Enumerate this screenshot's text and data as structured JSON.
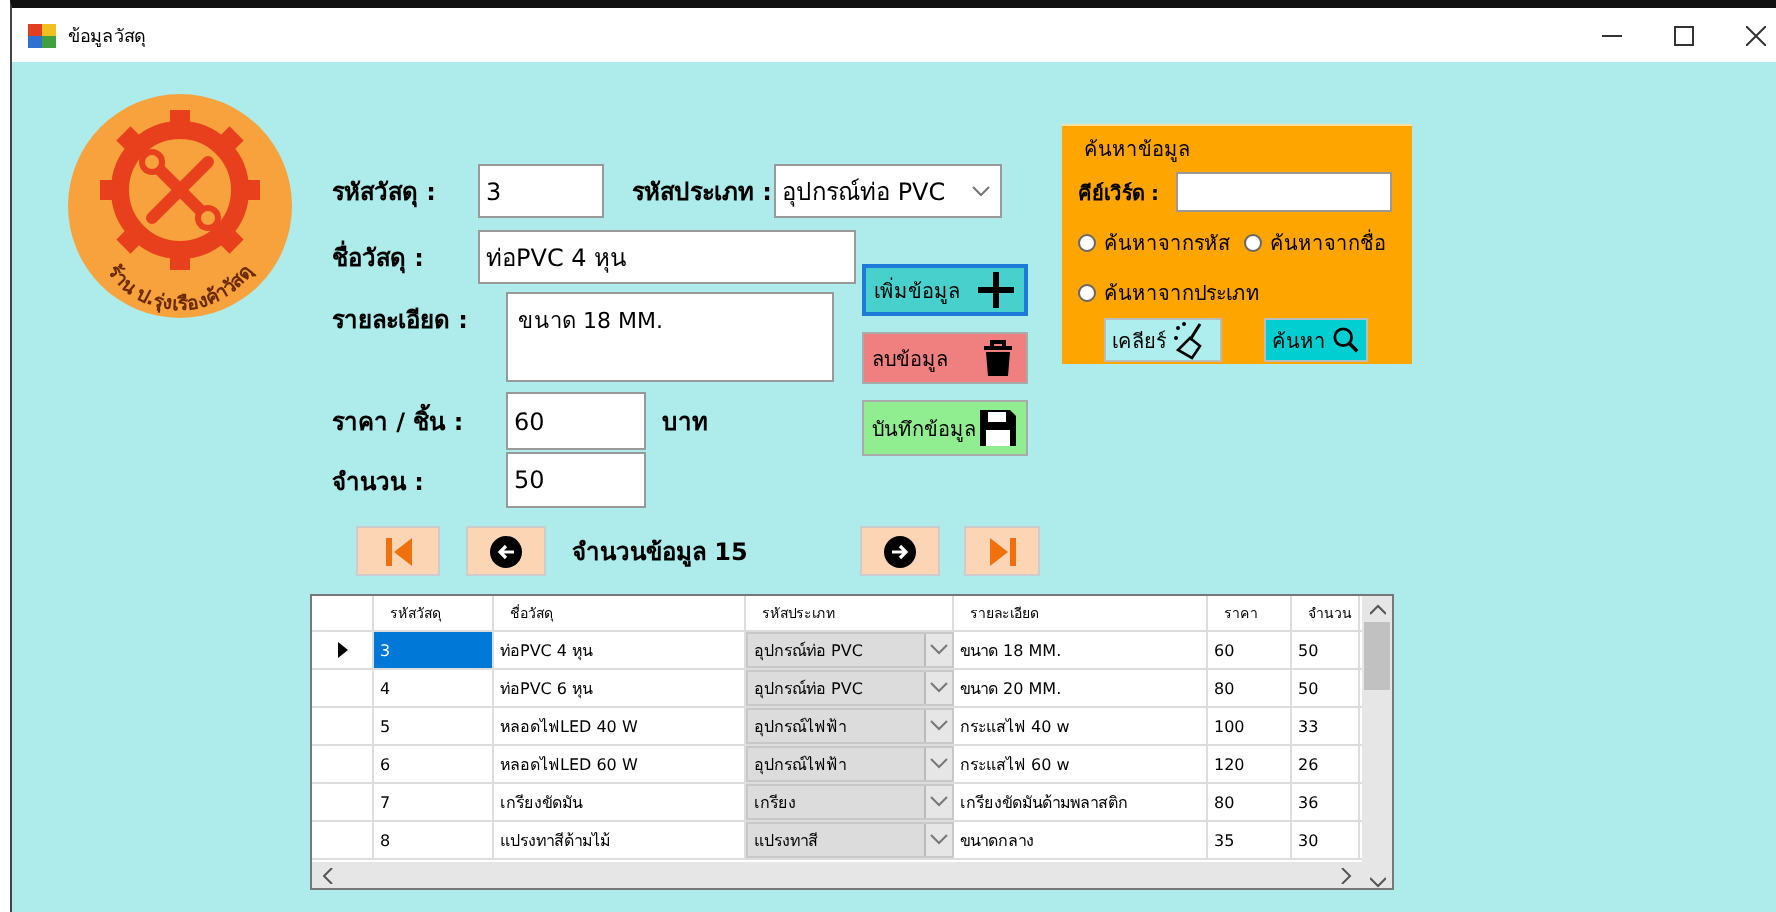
{
  "window": {
    "title": "ข้อมูลวัสดุ"
  },
  "logo": {
    "text": "ร้าน ป.รุ่งเรืองค้าวัสดุ"
  },
  "form": {
    "material_id": {
      "label": "รหัสวัสดุ :",
      "value": "3"
    },
    "type_code": {
      "label": "รหัสประเภท :",
      "value": "อุปกรณ์ท่อ PVC"
    },
    "name": {
      "label": "ชื่อวัสดุ :",
      "value": "ท่อPVC 4 หุน"
    },
    "detail": {
      "label": "รายละเอียด :",
      "value": "ขนาด 18 MM."
    },
    "price": {
      "label": "ราคา / ชิ้น :",
      "value": "60",
      "unit": "บาท"
    },
    "quantity": {
      "label": "จำนวน :",
      "value": "50"
    }
  },
  "actions": [
    {
      "label": "เพิ่มข้อมูล",
      "kind": "add",
      "focused": true
    },
    {
      "label": "ลบข้อมูล",
      "kind": "delete",
      "focused": false
    },
    {
      "label": "บันทึกข้อมูล",
      "kind": "save",
      "focused": false
    }
  ],
  "search": {
    "title": "ค้นหาข้อมูล",
    "keyword_label": "คีย์เวิร์ด :",
    "options": [
      {
        "label": "ค้นหาจากรหัส",
        "selected": false
      },
      {
        "label": "ค้นหาจากชื่อ",
        "selected": false
      },
      {
        "label": "ค้นหาจากประเภท",
        "selected": false
      }
    ],
    "buttons": [
      {
        "label": "เคลียร์",
        "kind": "clear"
      },
      {
        "label": "ค้นหา",
        "kind": "search"
      }
    ]
  },
  "navigator": {
    "buttons": [
      {
        "kind": "first"
      },
      {
        "kind": "prev"
      },
      {
        "kind": "next"
      },
      {
        "kind": "last"
      }
    ],
    "count_label": "จำนวนข้อมูล 15"
  },
  "table": {
    "columns": [
      "รหัสวัสดุ",
      "ชื่อวัสดุ",
      "รหัสประเภท",
      "รายละเอียด",
      "ราคา",
      "จำนวน"
    ],
    "rows": [
      {
        "cells": [
          "3",
          "ท่อPVC 4 หุน",
          "อุปกรณ์ท่อ PVC",
          "ขนาด 18 MM.",
          "60",
          "50"
        ],
        "selected": true
      },
      {
        "cells": [
          "4",
          "ท่อPVC 6 หุน",
          "อุปกรณ์ท่อ PVC",
          "ขนาด 20 MM.",
          "80",
          "50"
        ],
        "selected": false
      },
      {
        "cells": [
          "5",
          "หลอดไฟLED 40 W",
          "อุปกรณ์ไฟฟ้า",
          "กระแสไฟ 40 w",
          "100",
          "33"
        ],
        "selected": false
      },
      {
        "cells": [
          "6",
          "หลอดไฟLED 60 W",
          "อุปกรณ์ไฟฟ้า",
          "กระแสไฟ 60 w",
          "120",
          "26"
        ],
        "selected": false
      },
      {
        "cells": [
          "7",
          "เกรียงขัดมัน",
          "เกรียง",
          "เกรียงขัดมันด้ามพลาสติก",
          "80",
          "36"
        ],
        "selected": false
      },
      {
        "cells": [
          "8",
          "แปรงทาสีด้ามไม้",
          "แปรงทาสี",
          "ขนาดกลาง",
          "35",
          "30"
        ],
        "selected": false
      }
    ]
  }
}
